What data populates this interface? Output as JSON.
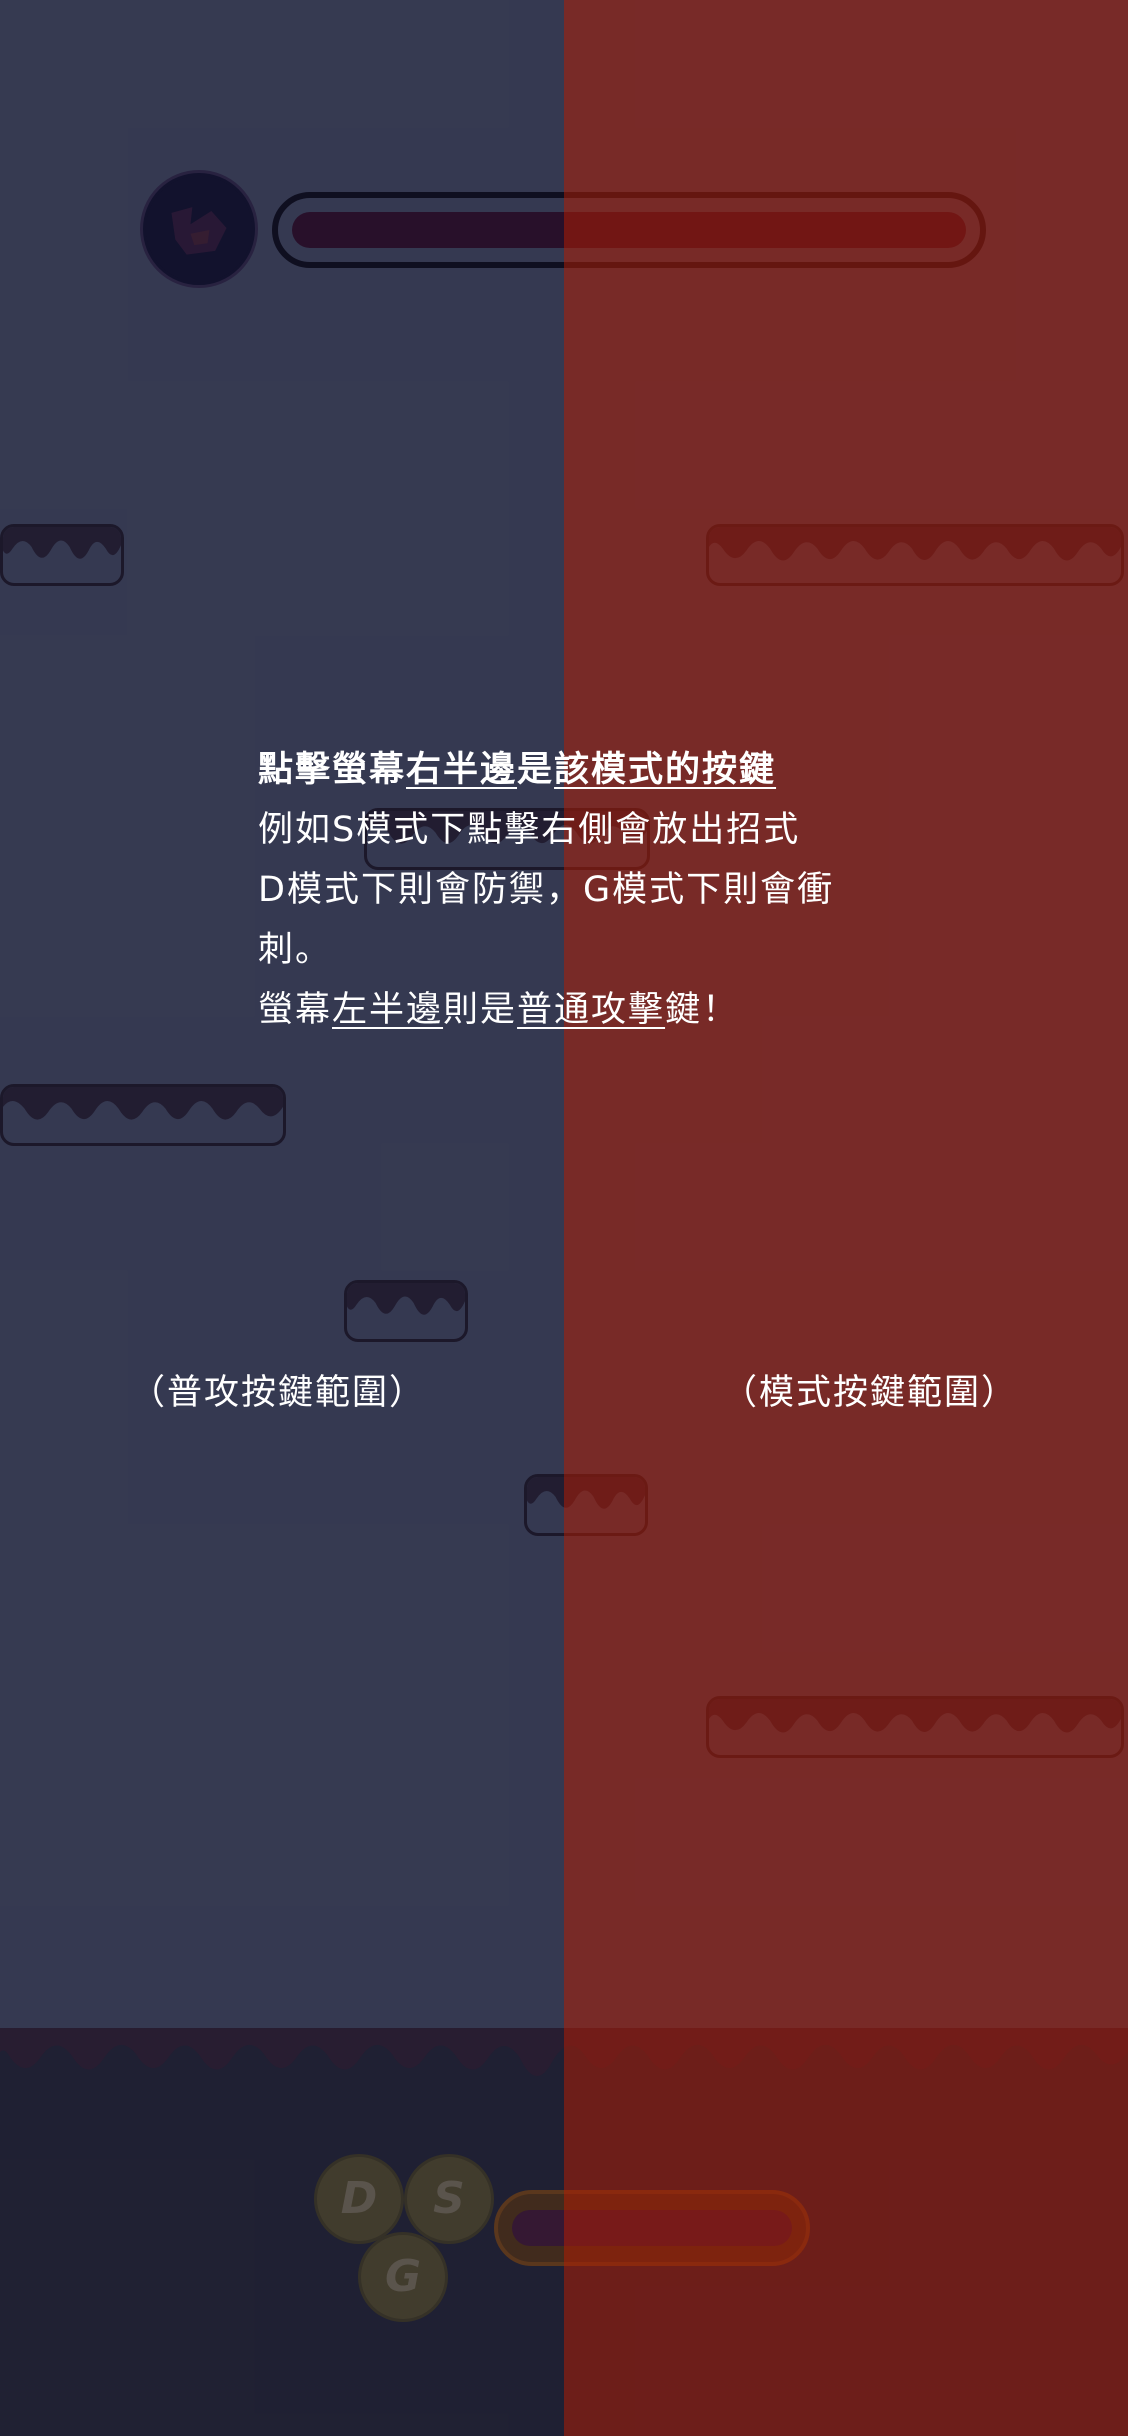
{
  "tutorial": {
    "line1": {
      "p1": "點擊螢幕",
      "u1": "右半邊",
      "p2": "是",
      "u2": "該模式的按鍵"
    },
    "line2": "例如S模式下點擊右側會放出招式",
    "line3": "D模式下則會防禦，G模式下則會衝",
    "line4": "刺。",
    "line5": {
      "p1": "螢幕",
      "u1": "左半邊",
      "p2": "則是",
      "u2": "普通攻擊",
      "p3": "鍵！"
    }
  },
  "regions": {
    "left_label": "（普攻按鍵範圍）",
    "right_label": "（模式按鍵範圍）"
  },
  "controls": {
    "buttons": [
      "D",
      "S",
      "G"
    ]
  },
  "hud": {
    "player_hp_fraction": 1.0,
    "mode_gauge_fraction": 1.0
  },
  "colors": {
    "left_overlay": "#262a3e",
    "right_overlay": "#9e1e0c",
    "left_overlay_opacity": 0.22,
    "right_overlay_opacity": 0.62,
    "platform_drip": "#221a2e"
  },
  "icons": {
    "player_avatar": "character-portrait-icon"
  }
}
